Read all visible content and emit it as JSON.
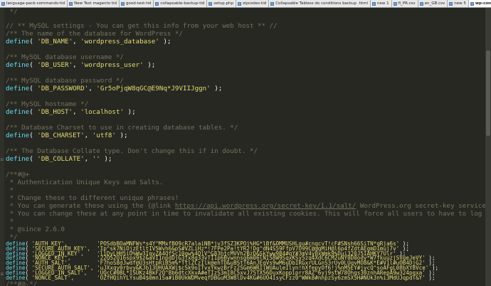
{
  "tabs": [
    {
      "label": "language-pack-commands-tid"
    },
    {
      "label": "New Test magento tid"
    },
    {
      "label": "good-test-tid"
    },
    {
      "label": "collapsable-backup-tid"
    },
    {
      "label": "setup.php"
    },
    {
      "label": "zipcodes-tid"
    },
    {
      "label": "Collapsable Tabless do conditions backup .html"
    },
    {
      "label": "new 1"
    },
    {
      "label": "fi_PR.csv"
    },
    {
      "label": "en_GB.csv"
    },
    {
      "label": "new 5"
    },
    {
      "label": "wp-config.php"
    }
  ],
  "code": {
    "l0_close": " */",
    "l1_settings": "// ** MySQL settings - You can get this info from your web host ** //",
    "l2_dbname_comment": "/** The name of the database for WordPress */",
    "l3_fn": "define",
    "dbname_key": "'DB_NAME'",
    "dbname_val": "'wordpress_database'",
    "user_comment": "/** MySQL database username */",
    "user_key": "'DB_USER'",
    "user_val": "'wordpress_user'",
    "pass_comment": "/** MySQL database password */",
    "pass_key": "'DB_PASSWORD'",
    "pass_val": "'Gr5oPjqW8qGC@E9Nq*J9VIIJggn'",
    "host_comment": "/** MySQL hostname */",
    "host_key": "'DB_HOST'",
    "host_val": "'localhost'",
    "charset_comment": "/** Database Charset to use in creating database tables. */",
    "charset_key": "'DB_CHARSET'",
    "charset_val": "'utf8'",
    "collate_comment": "/** The Database Collate type. Don't change this if in doubt. */",
    "collate_key": "'DB_COLLATE'",
    "collate_val": "''",
    "auth_open": "/**#@+",
    "auth_title": " * Authentication Unique Keys and Salts.",
    "auth_blank": " *",
    "auth_change": " * Change these to different unique phrases!",
    "auth_gen_pre": " * You can generate these using the {@link ",
    "auth_gen_url": "https://api.wordpress.org/secret-key/1.1/salt/",
    "auth_gen_post": " WordPress.org secret-key service}",
    "auth_anytime": " * You can change these at any point in time to invalidate all existing cookies. This will force all users to have to log in again.",
    "auth_blank2": " *",
    "auth_since": " * @since 2.6.0",
    "auth_close": " */",
    "keys": [
      {
        "key": "'AUTH_KEY',",
        "pad": "         ",
        "val": "'POSdbBOaMNFWs*s4Y^MMxfB09cR7alaiNB*jv3fSZ3KPOj%HG*lBf&OMMUSHLgu#cnqcvT!cF#SNsh66SiTN*qRja6s'"
      },
      {
        "key": "'SECURE_AUTH_KEY',",
        "pad": "  ",
        "val": "'Ip^sk7NiOjzEtltIV5Wvh6&pS#VZLiHz*!7FPe2Pa!tYR2!Dg^dN4S59FfpV7O99C@@gMiH@l6p4fZdtAEgmD1muj7v'"
      },
      {
        "key": "'LOGGED_IN_KEY',",
        "pad": "    ",
        "val": "'liDyLHH5iO%Ww3IqvZA4QfSc10gw%4QlV^G83htcMVVh2BzD&SkYww9B4#qY#3mV4y0xWmk9%Dui320J5IAHKY7Ulr'"
      },
      {
        "key": "'NONCE_KEY',",
        "pad": "        ",
        "val": "'22Q52Q16spx9$z&aVI1npdDjG3jx8g33vTI1p6Bywnnsg6m06lNI58W9SqxKSy5zq4XdC6CM2uNY0D0ody*W7fkuuzjSVgeJeVY'"
      },
      {
        "key": "'AUTH_SALT',",
        "pad": "        ",
        "val": "'F7hoS8dJwdf@U3sHtpRiB5m%*TtlZCzIlk@ehTD&uBStT6AnJEqVs9wM6uDbIRGxrULGnS3rUy0LUqvMO8&K*E#V1l#uOB4DjG2'"
      },
      {
        "key": "'SECURE_AUTH_SALT',",
        "pad": " ",
        "val": "'uJXxqy0rbvy&KJb13UHUAXWi$cSk9oITvxYkwzBrFz2SGm6WRIlWUAuleIlyn!hXfepyOf6!j%nM5EY#jycQ^soAFgL08bXY8Vce'"
      },
      {
        "key": "'LOGGED_IN_SALT',",
        "pad": "   ",
        "val": "'UQcC#0BL*ISUKz4BkF2Q^8b6dtcXkvA#eTIzS3mI8C5xvJ75TX56DuxKoppiprr8AZ^6yj9stW78Ohgs30znhARepA9w324pqxa'"
      },
      {
        "key": "'NONCE_SALT',",
        "pad": "       ",
        "val": "'OZfHQihYLYsuB4$0mn1Sa#iB0UkWDMveqfDBGuM3W8lDv4KG#6UO4IsyCFzz0^WWk8#nhpzSy6zmSX5H#NUk3n%i3MdUJqpdT&Y'"
      }
    ],
    "final": "/**#@-*/",
    "define_fn": "define",
    "open_paren": "( ",
    "comma": ", ",
    "close": " );",
    "comma_only": ", ",
    "space": " "
  },
  "colors": {
    "background": "#272822",
    "comment": "#75715e",
    "function": "#66d9ef",
    "string": "#e6db74"
  }
}
